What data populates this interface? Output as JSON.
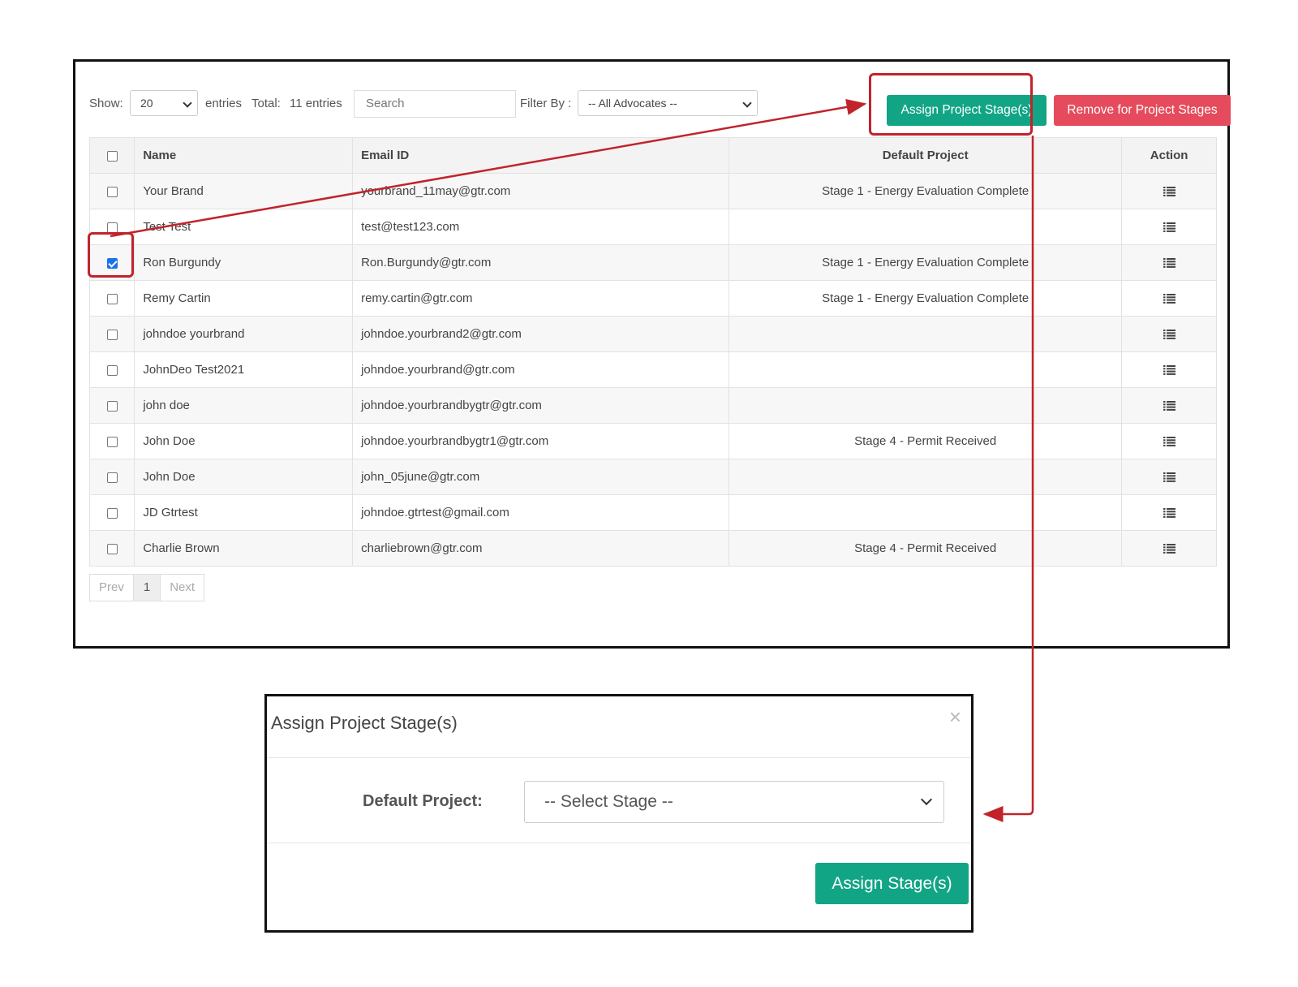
{
  "toolbar": {
    "show_label": "Show:",
    "page_size": "20",
    "entries_label": "entries",
    "total_label": "Total:",
    "total_value": "11 entries",
    "search_placeholder": "Search",
    "filter_label": "Filter By :",
    "filter_value": "-- All Advocates --",
    "assign_button": "Assign Project Stage(s)",
    "remove_button": "Remove for Project Stages"
  },
  "table": {
    "headers": {
      "name": "Name",
      "email": "Email ID",
      "project": "Default Project",
      "action": "Action"
    },
    "rows": [
      {
        "name": "Your Brand",
        "email": "yourbrand_11may@gtr.com",
        "project": "Stage 1 - Energy Evaluation Complete",
        "checked": false
      },
      {
        "name": "Test Test",
        "email": "test@test123.com",
        "project": "",
        "checked": false
      },
      {
        "name": "Ron Burgundy",
        "email": "Ron.Burgundy@gtr.com",
        "project": "Stage 1 - Energy Evaluation Complete",
        "checked": true
      },
      {
        "name": "Remy Cartin",
        "email": "remy.cartin@gtr.com",
        "project": "Stage 1 - Energy Evaluation Complete",
        "checked": false
      },
      {
        "name": "johndoe yourbrand",
        "email": "johndoe.yourbrand2@gtr.com",
        "project": "",
        "checked": false
      },
      {
        "name": "JohnDeo Test2021",
        "email": "johndoe.yourbrand@gtr.com",
        "project": "",
        "checked": false
      },
      {
        "name": "john doe",
        "email": "johndoe.yourbrandbygtr@gtr.com",
        "project": "",
        "checked": false
      },
      {
        "name": "John Doe",
        "email": "johndoe.yourbrandbygtr1@gtr.com",
        "project": "Stage 4 - Permit Received",
        "checked": false
      },
      {
        "name": "John Doe",
        "email": "john_05june@gtr.com",
        "project": "",
        "checked": false
      },
      {
        "name": "JD Gtrtest",
        "email": "johndoe.gtrtest@gmail.com",
        "project": "",
        "checked": false
      },
      {
        "name": "Charlie Brown",
        "email": "charliebrown@gtr.com",
        "project": "Stage 4 - Permit Received",
        "checked": false
      }
    ]
  },
  "pager": {
    "prev": "Prev",
    "current": "1",
    "next": "Next"
  },
  "modal": {
    "title": "Assign Project Stage(s)",
    "close": "×",
    "field_label": "Default Project:",
    "select_value": "-- Select Stage --",
    "submit": "Assign Stage(s)"
  },
  "colors": {
    "accent": "#12a585",
    "danger": "#e54b5c",
    "highlight": "#c1232b",
    "checkbox": "#1a73e8"
  },
  "icons": {
    "row_action": "list-icon",
    "dropdown": "chevron-down-icon",
    "close": "close-icon"
  }
}
